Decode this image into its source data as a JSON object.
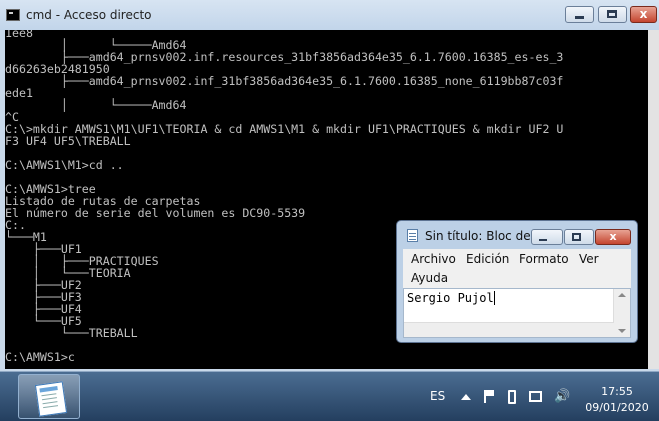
{
  "cmd": {
    "title": "cmd - Acceso directo",
    "lines": [
      "1ee8",
      "        │      └─────Amd64",
      "        ├───amd64_prnsv002.inf.resources_31bf3856ad364e35_6.1.7600.16385_es-es_3",
      "d66263eb2481950",
      "        ├───amd64_prnsv002.inf_31bf3856ad364e35_6.1.7600.16385_none_6119bb87c03f",
      "ede1",
      "        │      └─────Amd64",
      "^C",
      "C:\\>mkdir AMWS1\\M1\\UF1\\TEORIA & cd AMWS1\\M1 & mkdir UF1\\PRACTIQUES & mkdir UF2 U",
      "F3 UF4 UF5\\TREBALL",
      "",
      "C:\\AMWS1\\M1>cd ..",
      "",
      "C:\\AMWS1>tree",
      "Listado de rutas de carpetas",
      "El número de serie del volumen es DC90-5539",
      "C:.",
      "└───M1",
      "    ├───UF1",
      "    │   ├───PRACTIQUES",
      "    │   └───TEORIA",
      "    ├───UF2",
      "    ├───UF3",
      "    ├───UF4",
      "    └───UF5",
      "        └───TREBALL",
      "",
      "C:\\AMWS1>c"
    ],
    "controls": {
      "close_glyph": "x"
    }
  },
  "notepad": {
    "title": "Sin título: Bloc de...",
    "menu": [
      "Archivo",
      "Edición",
      "Formato",
      "Ver",
      "Ayuda"
    ],
    "content": "Sergio Pujol",
    "controls": {
      "close_glyph": "x"
    }
  },
  "taskbar": {
    "language": "ES",
    "time": "17:55",
    "date": "09/01/2020",
    "tray_icons": [
      "show-hidden-icon",
      "flag-icon",
      "battery-icon",
      "network-icon",
      "volume-icon"
    ],
    "pinned": [
      {
        "name": "notepad-icon"
      }
    ]
  },
  "colors": {
    "terminal_bg": "#000000",
    "terminal_fg": "#c0c0c0",
    "taskbar": "#2f5077",
    "close_button": "#c4452f"
  }
}
